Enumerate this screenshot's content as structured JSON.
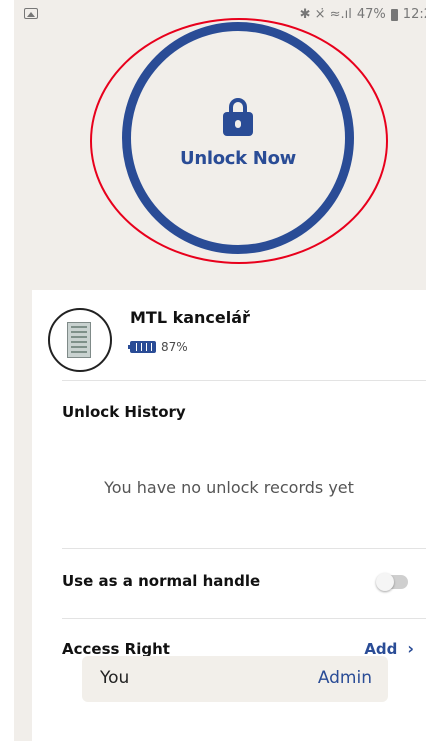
{
  "status_bar": {
    "left_icon": "image-icon",
    "indicators": "✱ ×̇ ≈.ıl",
    "battery_pct": "47%",
    "time": "12:2"
  },
  "unlock_button": {
    "icon": "lock-icon",
    "label": "Unlock Now",
    "color": "#2a4c96"
  },
  "lock": {
    "name": "MTL kancelář",
    "battery": "87%",
    "avatar_icon": "building-icon"
  },
  "unlock_history": {
    "title": "Unlock History",
    "empty_message": "You have no unlock records yet"
  },
  "normal_handle": {
    "label": "Use as a normal handle",
    "enabled": false
  },
  "access_right": {
    "title": "Access Right",
    "add_label": "Add",
    "entries": [
      {
        "user": "You",
        "role": "Admin"
      }
    ]
  }
}
